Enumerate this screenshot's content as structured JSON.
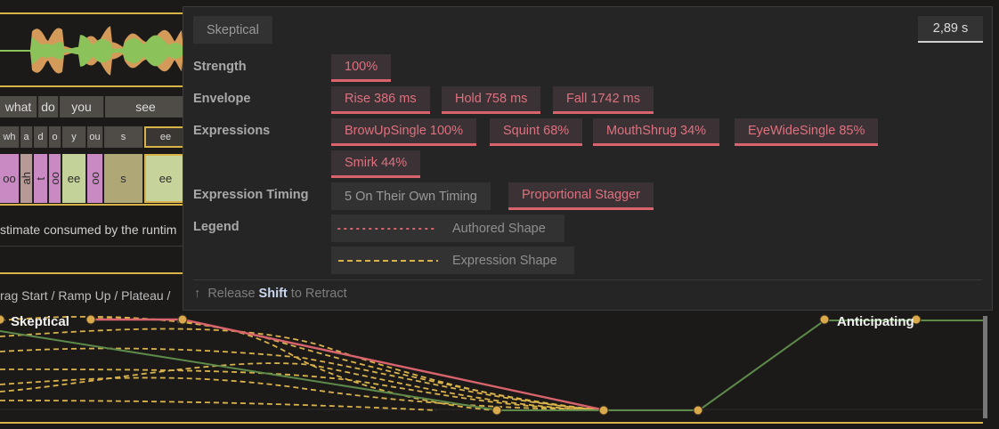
{
  "background": {
    "words": [
      "what",
      "do",
      "you",
      "see"
    ],
    "phonemes": [
      "wh",
      "a",
      "d",
      "o",
      "y",
      "ou",
      "s",
      "ee"
    ],
    "visemes": [
      "oo",
      "ah",
      "t",
      "oo",
      "ee",
      "oo",
      "s",
      "ee"
    ],
    "estimate_text": "stimate consumed by the runtim",
    "drag_text": "rag Start / Ramp Up / Plateau /",
    "curve_labels": {
      "skeptical": "Skeptical",
      "anticipating": "Anticipating"
    },
    "colors": {
      "gold": "#d7b34a",
      "waveform_green": "#8bc35a",
      "waveform_orange": "#d49a5a",
      "authored": "#d9646e",
      "envelope_green": "#5d8a4a"
    }
  },
  "popup": {
    "title": "Skeptical",
    "duration": "2,89 s",
    "strength": {
      "label": "Strength",
      "value": "100%"
    },
    "envelope": {
      "label": "Envelope",
      "rise": "Rise 386 ms",
      "hold": "Hold 758 ms",
      "fall": "Fall 1742 ms"
    },
    "expressions": {
      "label": "Expressions",
      "items": [
        "BrowUpSingle 100%",
        "Squint 68%",
        "MouthShrug 34%",
        "EyeWideSingle 85%",
        "Smirk 44%"
      ]
    },
    "timing": {
      "label": "Expression Timing",
      "options": [
        "5 On Their Own Timing",
        "Proportional Stagger"
      ],
      "selected": "Proportional Stagger"
    },
    "legend": {
      "label": "Legend",
      "authored": "Authored Shape",
      "expression": "Expression Shape"
    },
    "hint": {
      "arrow": "↑",
      "pre": "Release",
      "key": "Shift",
      "post": "to Retract"
    }
  }
}
